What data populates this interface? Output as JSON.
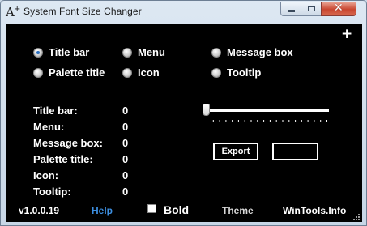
{
  "window": {
    "title": "System Font Size Changer",
    "icon_text": "A",
    "icon_plus": "+"
  },
  "controls": {
    "minimize_icon": "minimize-icon",
    "maximize_icon": "maximize-icon",
    "close_glyph": "✕"
  },
  "toolbar": {
    "plus_label": "+"
  },
  "elements": {
    "selected": "Title bar",
    "options": [
      {
        "label": "Title bar",
        "checked": true
      },
      {
        "label": "Menu",
        "checked": false
      },
      {
        "label": "Message box",
        "checked": false
      },
      {
        "label": "Palette title",
        "checked": false
      },
      {
        "label": "Icon",
        "checked": false
      },
      {
        "label": "Tooltip",
        "checked": false
      }
    ]
  },
  "sizes": [
    {
      "label": "Title bar:",
      "value": "0"
    },
    {
      "label": "Menu:",
      "value": "0"
    },
    {
      "label": "Message box:",
      "value": "0"
    },
    {
      "label": "Palette title:",
      "value": "0"
    },
    {
      "label": "Icon:",
      "value": "0"
    },
    {
      "label": "Tooltip:",
      "value": "0"
    }
  ],
  "slider": {
    "value_fraction": 0,
    "tick_count": 20
  },
  "buttons": {
    "export_label": "Export",
    "blank_label": ""
  },
  "footer": {
    "version": "v1.0.0.19",
    "help": "Help",
    "bold_label": "Bold",
    "bold_checked": false,
    "theme": "Theme",
    "brand": "WinTools.Info"
  },
  "colors": {
    "background": "#000000",
    "text": "#ffffff",
    "help_link": "#3d8fe0",
    "close_button": "#c8452f"
  }
}
